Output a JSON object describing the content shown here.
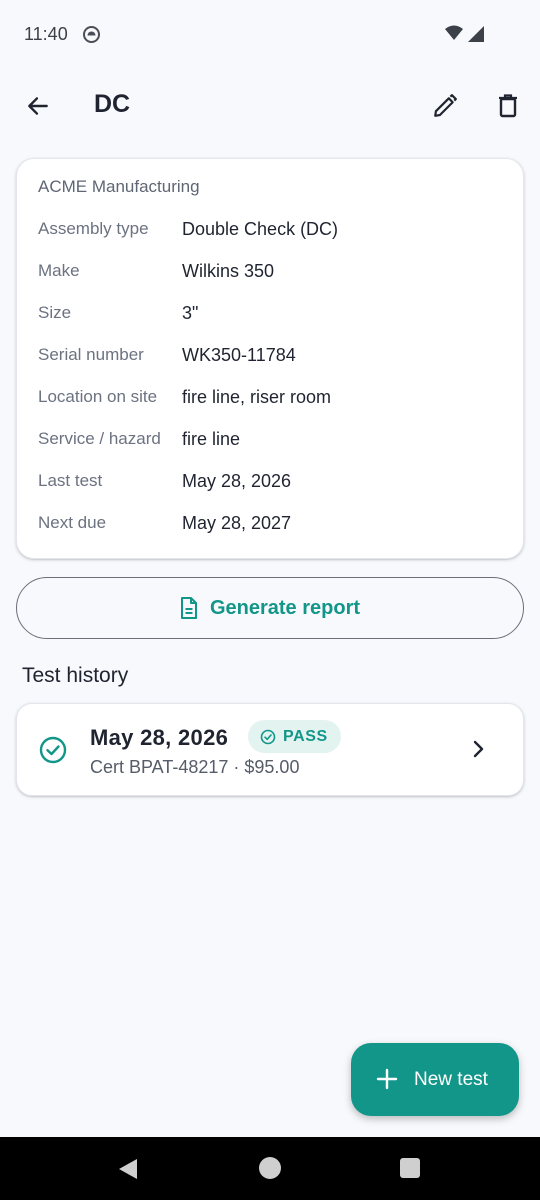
{
  "status_bar": {
    "time": "11:40"
  },
  "app_bar": {
    "title": "DC",
    "back_icon": "arrow-left-icon",
    "edit_icon": "pencil-icon",
    "delete_icon": "trash-icon"
  },
  "details": {
    "company": "ACME Manufacturing",
    "rows": [
      {
        "label": "Assembly type",
        "value": "Double Check (DC)"
      },
      {
        "label": "Make",
        "value": "Wilkins 350"
      },
      {
        "label": "Size",
        "value": "3\""
      },
      {
        "label": "Serial number",
        "value": "WK350-11784"
      },
      {
        "label": "Location on site",
        "value": "fire line, riser room"
      },
      {
        "label": "Service / hazard",
        "value": "fire line"
      },
      {
        "label": "Last test",
        "value": "May 28, 2026"
      },
      {
        "label": "Next due",
        "value": "May 28, 2027"
      }
    ]
  },
  "report_button": {
    "label": "Generate report",
    "icon": "document-icon"
  },
  "history": {
    "title": "Test history",
    "items": [
      {
        "date": "May 28, 2026",
        "status": "PASS",
        "meta": "Cert BPAT-48217 · $95.00"
      }
    ]
  },
  "fab": {
    "label": "New test",
    "icon": "plus-icon"
  },
  "colors": {
    "accent": "#13968a",
    "badge_bg": "#e3f3f0",
    "background": "#f8f9fc"
  }
}
